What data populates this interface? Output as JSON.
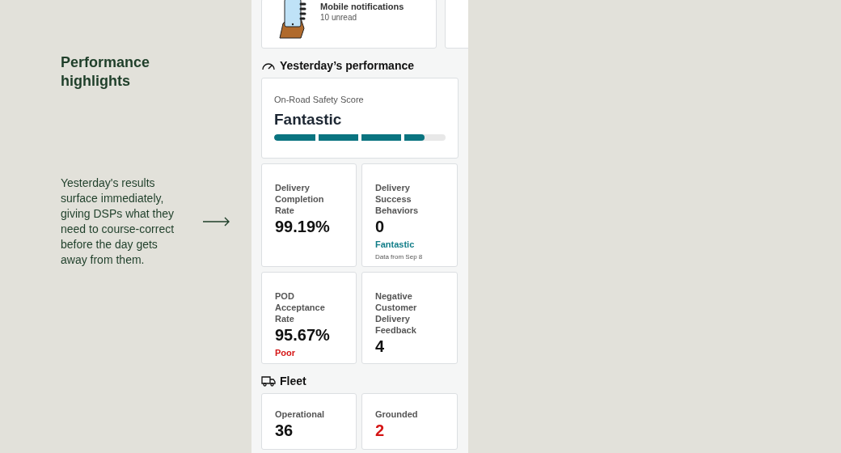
{
  "caption": {
    "title": "Performance highlights",
    "body": "Yesterday's results surface immediately, giving DSPs what they need to course-correct before the day gets away from them."
  },
  "notifications": {
    "title": "Mobile notifications",
    "subtitle": "10 unread"
  },
  "performance": {
    "heading": "Yesterday’s performance",
    "safety": {
      "label": "On-Road Safety Score",
      "value": "Fantastic",
      "level": 0.875
    },
    "metrics": [
      {
        "label": "Delivery Completion Rate",
        "value": "99.19%"
      },
      {
        "label": "Delivery Success Behaviors",
        "value": "0",
        "rating": "Fantastic",
        "kind": "good",
        "note": "Data from Sep 8"
      },
      {
        "label": "POD Acceptance Rate",
        "value": "95.67%",
        "rating": "Poor",
        "kind": "poor"
      },
      {
        "label": "Negative Customer Delivery Feedback",
        "value": "4"
      }
    ]
  },
  "fleet": {
    "heading": "Fleet",
    "items": [
      {
        "label": "Operational",
        "value": "36",
        "alert": false
      },
      {
        "label": "Grounded",
        "value": "2",
        "alert": true
      }
    ]
  }
}
